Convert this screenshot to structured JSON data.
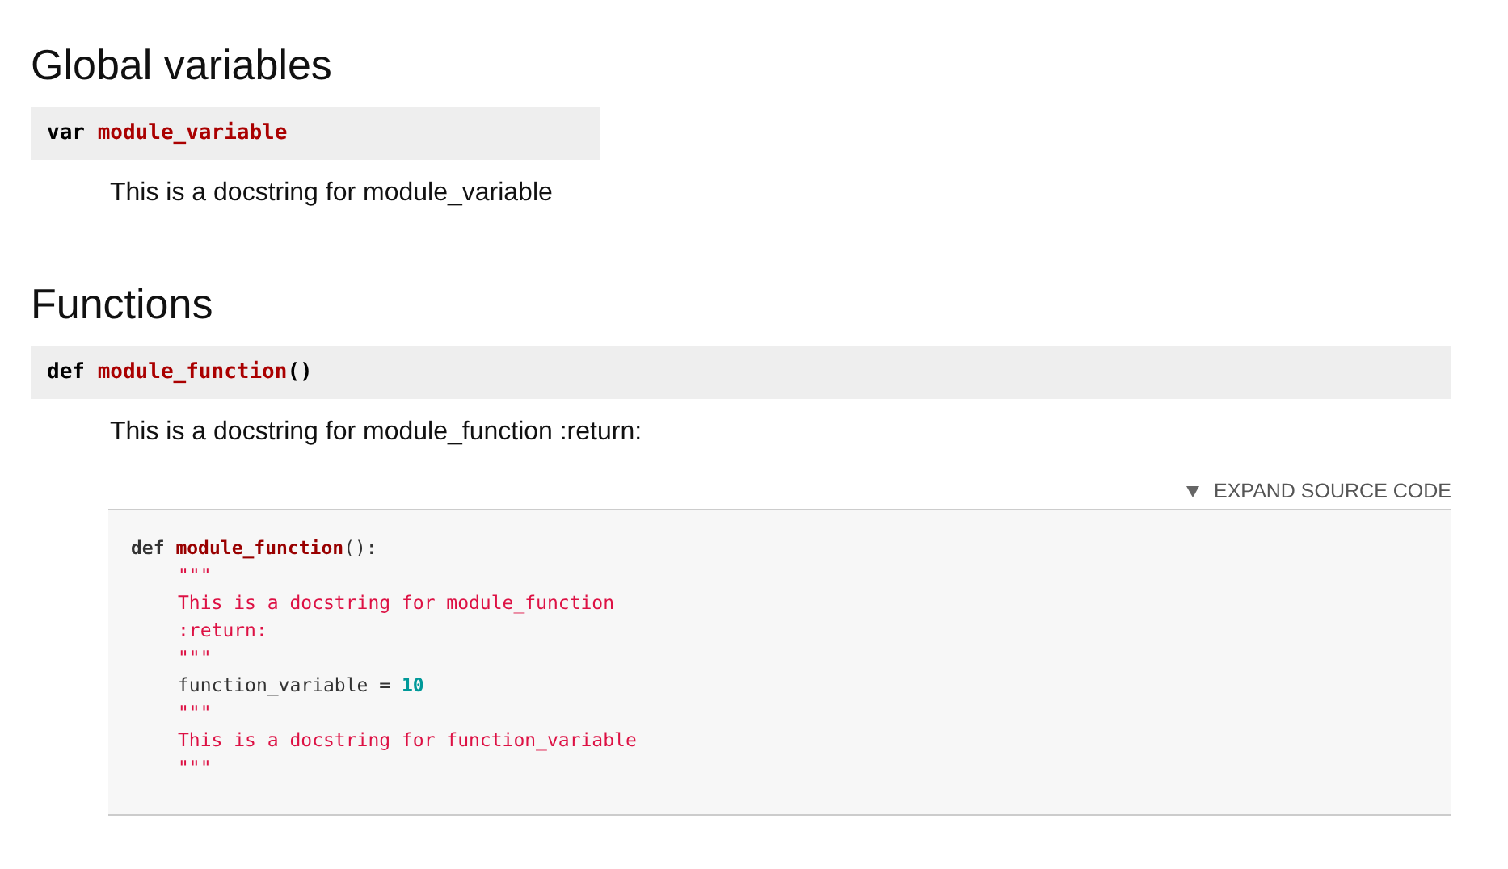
{
  "sections": [
    {
      "heading": "Global variables",
      "items": [
        {
          "keyword": "var",
          "name": "module_variable",
          "wide": false,
          "doc": "This is a docstring for module_variable"
        }
      ]
    },
    {
      "heading": "Functions",
      "items": [
        {
          "keyword": "def",
          "name": "module_function",
          "suffix": "()",
          "wide": true,
          "doc": "This is a docstring for module_function :return:",
          "source_toggle": "EXPAND SOURCE CODE",
          "source": [
            {
              "tokens": [
                {
                  "kind": "keyword",
                  "text": "def"
                },
                {
                  "kind": "name",
                  "text": "module_function"
                },
                {
                  "kind": "plain",
                  "text": "():"
                }
              ],
              "children": [
                {
                  "tokens": [
                    {
                      "kind": "string",
                      "text": "\"\"\""
                    }
                  ]
                },
                {
                  "tokens": [
                    {
                      "kind": "string",
                      "text": "This is a docstring for module_function"
                    }
                  ]
                },
                {
                  "tokens": [
                    {
                      "kind": "string",
                      "text": ":return:"
                    }
                  ]
                },
                {
                  "tokens": [
                    {
                      "kind": "string",
                      "text": "\"\"\""
                    }
                  ]
                },
                {
                  "tokens": [
                    {
                      "kind": "plain",
                      "text": "function_variable = "
                    },
                    {
                      "kind": "number",
                      "text": "10"
                    }
                  ]
                },
                {
                  "tokens": [
                    {
                      "kind": "string",
                      "text": "\"\"\""
                    }
                  ]
                },
                {
                  "tokens": [
                    {
                      "kind": "string",
                      "text": "This is a docstring for function_variable"
                    }
                  ]
                },
                {
                  "tokens": [
                    {
                      "kind": "string",
                      "text": "\"\"\""
                    }
                  ]
                }
              ]
            }
          ]
        }
      ]
    }
  ]
}
